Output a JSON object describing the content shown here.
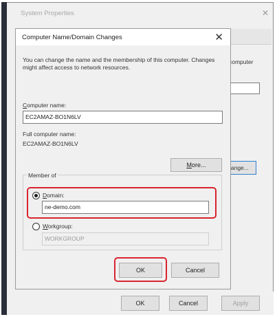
{
  "background_window": {
    "title": "System Properties",
    "side_text": "computer",
    "change_button": "Change...",
    "ok_button": "OK",
    "cancel_button": "Cancel",
    "apply_button": "Apply"
  },
  "dialog": {
    "title": "Computer Name/Domain Changes",
    "description": "You can change the name and the membership of this computer. Changes might affect access to network resources.",
    "computer_name_label_u": "C",
    "computer_name_label_rest": "omputer name:",
    "computer_name_value": "EC2AMAZ-BO1N6LV",
    "full_name_label": "Full computer name:",
    "full_name_value": "EC2AMAZ-BO1N6LV",
    "more_button_u": "M",
    "more_button_rest": "ore...",
    "member_of_label": "Member of",
    "domain_label_u": "D",
    "domain_label_rest": "omain:",
    "domain_value": "ne-demo.com",
    "domain_selected": true,
    "workgroup_label_u": "W",
    "workgroup_label_rest": "orkgroup:",
    "workgroup_value": "WORKGROUP",
    "ok_button": "OK",
    "cancel_button": "Cancel"
  },
  "colors": {
    "highlight": "#d8242e",
    "focus_border": "#2c7fd1"
  }
}
